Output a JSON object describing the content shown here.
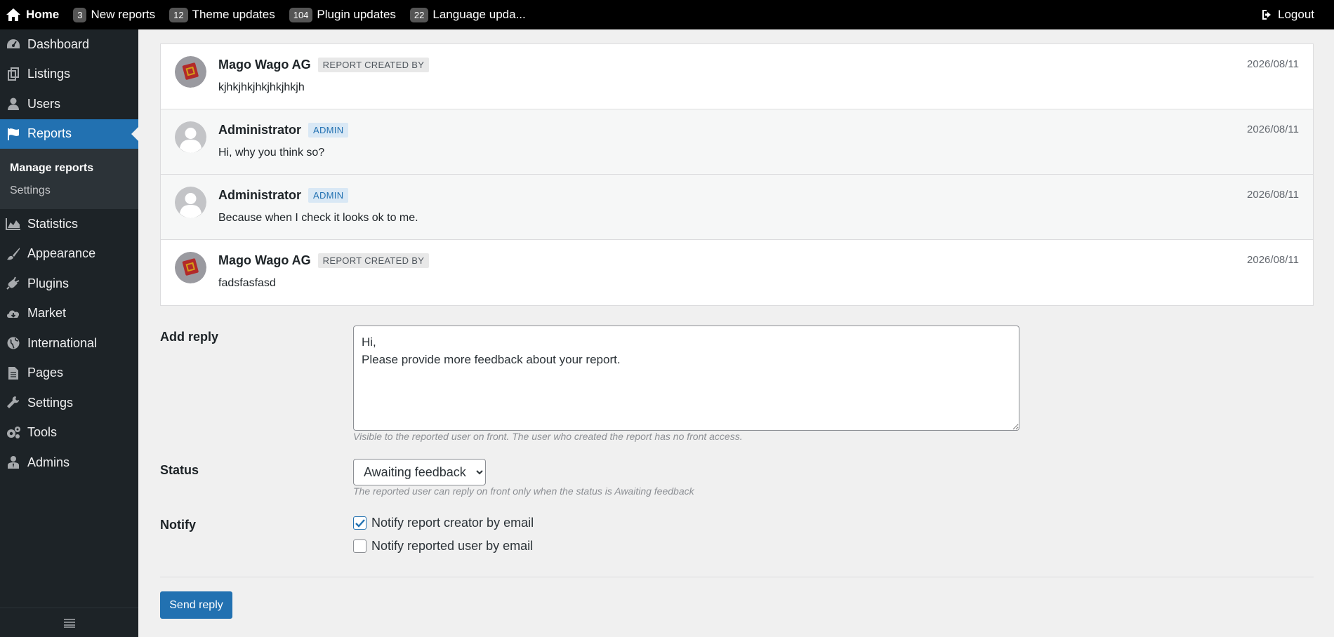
{
  "topbar": {
    "home": {
      "label": "Home",
      "icon": "home-icon"
    },
    "items": [
      {
        "badge": "3",
        "label": "New reports"
      },
      {
        "badge": "12",
        "label": "Theme updates"
      },
      {
        "badge": "104",
        "label": "Plugin updates"
      },
      {
        "badge": "22",
        "label": "Language upda..."
      }
    ],
    "logout": {
      "label": "Logout",
      "icon": "logout-icon"
    }
  },
  "sidebar": {
    "items": [
      {
        "label": "Dashboard",
        "icon": "dashboard-icon"
      },
      {
        "label": "Listings",
        "icon": "listings-icon"
      },
      {
        "label": "Users",
        "icon": "user-icon"
      },
      {
        "label": "Reports",
        "icon": "flag-icon",
        "active": true
      },
      {
        "label": "Statistics",
        "icon": "chart-icon"
      },
      {
        "label": "Appearance",
        "icon": "brush-icon"
      },
      {
        "label": "Plugins",
        "icon": "plug-icon"
      },
      {
        "label": "Market",
        "icon": "cloud-download-icon"
      },
      {
        "label": "International",
        "icon": "globe-icon"
      },
      {
        "label": "Pages",
        "icon": "page-icon"
      },
      {
        "label": "Settings",
        "icon": "wrench-icon"
      },
      {
        "label": "Tools",
        "icon": "gears-icon"
      },
      {
        "label": "Admins",
        "icon": "admin-user-icon"
      }
    ],
    "submenu": [
      {
        "label": "Manage reports",
        "current": true
      },
      {
        "label": "Settings"
      }
    ],
    "collapse_icon": "menu-collapse-icon"
  },
  "thread": {
    "messages": [
      {
        "author": "Mago Wago AG",
        "role": "REPORT CREATED BY",
        "date": "2026/08/11",
        "text": "kjhkjhkjhkjhkjhkjh"
      },
      {
        "author": "Administrator",
        "role": "ADMIN",
        "date": "2026/08/11",
        "text": "Hi, why you think so?"
      },
      {
        "author": "Administrator",
        "role": "ADMIN",
        "date": "2026/08/11",
        "text": "Because when I check it looks ok to me."
      },
      {
        "author": "Mago Wago AG",
        "role": "REPORT CREATED BY",
        "date": "2026/08/11",
        "text": "fadsfasfasd"
      }
    ]
  },
  "form": {
    "reply_label": "Add reply",
    "reply_value": "Hi,\nPlease provide more feedback about your report.",
    "reply_hint": "Visible to the reported user on front. The user who created the report has no front access.",
    "status_label": "Status",
    "status_value": "Awaiting feedback",
    "status_hint": "The reported user can reply on front only when the status is Awaiting feedback",
    "notify_label": "Notify",
    "notify_creator": "Notify report creator by email",
    "notify_creator_checked": true,
    "notify_reported": "Notify reported user by email",
    "notify_reported_checked": false,
    "send_label": "Send reply"
  },
  "colors": {
    "accent": "#2271b1",
    "sidebar_bg": "#1d2327",
    "topbar_bg": "#000000"
  }
}
